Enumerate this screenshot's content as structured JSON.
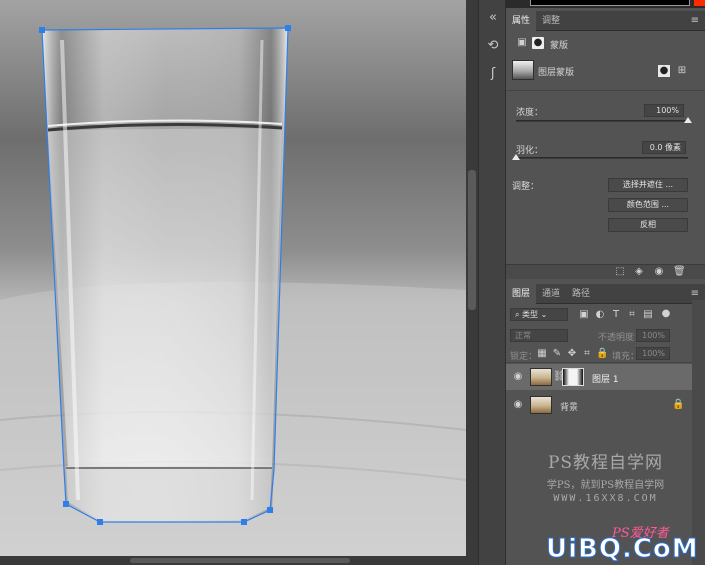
{
  "colors": {
    "accent_path": "#2f7fe8",
    "foreground_swatch": "#000000",
    "background_swatch": "#ff2a00"
  },
  "properties_panel": {
    "tabs": [
      "属性",
      "调整"
    ],
    "mask_type_label": "蒙版",
    "layer_mask_label": "图层蒙版",
    "density_label": "浓度：",
    "density_value": "100%",
    "density_level": 1.0,
    "feather_label": "羽化：",
    "feather_value": "0.0 像素",
    "feather_level": 0.0,
    "adjust_label": "调整：",
    "buttons": [
      "选择并遮住 ...",
      "颜色范围 ...",
      "反相"
    ]
  },
  "layers_panel": {
    "tabs": [
      "图层",
      "通道",
      "路径"
    ],
    "filter_kind": "类型",
    "blend_mode": "正常",
    "opacity_label": "不透明度：",
    "opacity_value": "100%",
    "lock_label": "锁定：",
    "fill_label": "填充：",
    "fill_value": "100%",
    "layers": [
      {
        "name": "图层 1",
        "visible": true,
        "selected": true,
        "has_mask": true
      },
      {
        "name": "背景",
        "visible": true,
        "selected": false,
        "locked": true
      }
    ]
  },
  "watermark": {
    "title": "PS教程自学网",
    "subtitle": "学PS，就到PS教程自学网",
    "url": "WWW.16XX8.COM"
  },
  "logo": {
    "text": "UiBQ.CoM",
    "ps_text": "PS爱好者"
  },
  "icons": [
    "collapse-icon",
    "history-icon",
    "paths-icon",
    "menu-icon",
    "image-icon",
    "pixel-mask-icon",
    "vector-mask-icon",
    "eye-icon",
    "lock-icon",
    "trash-icon",
    "link-icon"
  ]
}
